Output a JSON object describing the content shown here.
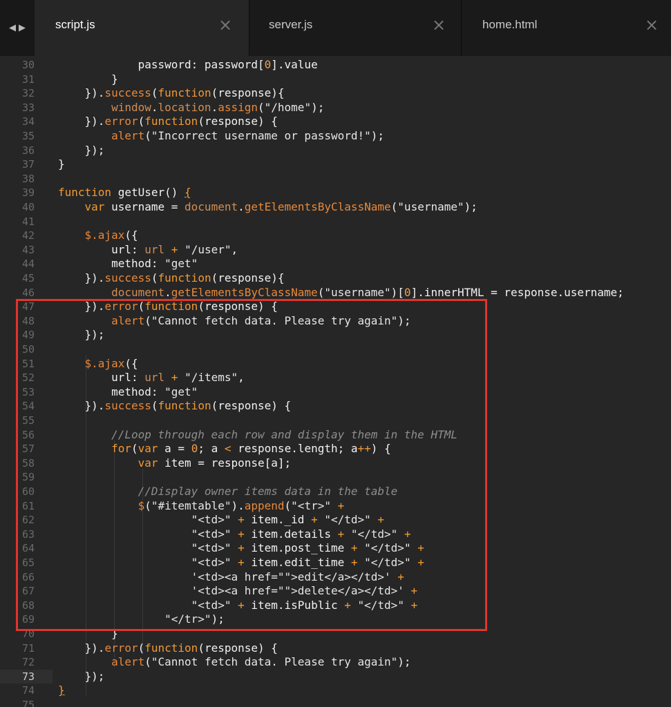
{
  "tabs": [
    {
      "label": "script.js",
      "active": true
    },
    {
      "label": "server.js",
      "active": false
    },
    {
      "label": "home.html",
      "active": false
    }
  ],
  "nav": {
    "back": "◀",
    "forward": "▶"
  },
  "icons": {
    "close": "×"
  },
  "colors": {
    "highlight_border": "#e0352e",
    "accent": "#f39a32",
    "background": "#262626"
  },
  "editor": {
    "current_line": 73,
    "lines": [
      {
        "n": "30",
        "code": [
          [
            "pl",
            "            password: password["
          ],
          [
            "num",
            "0"
          ],
          [
            "pl",
            "].value"
          ]
        ]
      },
      {
        "n": "31",
        "code": [
          [
            "pl",
            "        }"
          ]
        ]
      },
      {
        "n": "32",
        "code": [
          [
            "pl",
            "    })."
          ],
          [
            "fn",
            "success"
          ],
          [
            "pl",
            "("
          ],
          [
            "key",
            "function"
          ],
          [
            "pl",
            "(response){"
          ]
        ]
      },
      {
        "n": "33",
        "code": [
          [
            "pl",
            "        "
          ],
          [
            "glob",
            "window"
          ],
          [
            "pl",
            "."
          ],
          [
            "glob",
            "location"
          ],
          [
            "pl",
            "."
          ],
          [
            "fn",
            "assign"
          ],
          [
            "pl",
            "("
          ],
          [
            "str",
            "\"/home\""
          ],
          [
            "pl",
            ");"
          ]
        ]
      },
      {
        "n": "34",
        "code": [
          [
            "pl",
            "    })."
          ],
          [
            "fn",
            "error"
          ],
          [
            "pl",
            "("
          ],
          [
            "key",
            "function"
          ],
          [
            "pl",
            "(response) {"
          ]
        ]
      },
      {
        "n": "35",
        "code": [
          [
            "pl",
            "        "
          ],
          [
            "fn",
            "alert"
          ],
          [
            "pl",
            "("
          ],
          [
            "str",
            "\"Incorrect username or password!\""
          ],
          [
            "pl",
            ");"
          ]
        ]
      },
      {
        "n": "36",
        "code": [
          [
            "pl",
            "    });"
          ]
        ]
      },
      {
        "n": "37",
        "code": [
          [
            "pl",
            "}"
          ]
        ]
      },
      {
        "n": "38",
        "code": []
      },
      {
        "n": "39",
        "code": [
          [
            "key",
            "function"
          ],
          [
            "pl",
            " getUser() "
          ],
          [
            "u",
            "{"
          ]
        ]
      },
      {
        "n": "40",
        "code": [
          [
            "pl",
            "    "
          ],
          [
            "key",
            "var"
          ],
          [
            "pl",
            " username = "
          ],
          [
            "glob",
            "document"
          ],
          [
            "pl",
            "."
          ],
          [
            "fn",
            "getElementsByClassName"
          ],
          [
            "pl",
            "("
          ],
          [
            "str",
            "\"username\""
          ],
          [
            "pl",
            ");"
          ]
        ]
      },
      {
        "n": "41",
        "code": []
      },
      {
        "n": "42",
        "code": [
          [
            "pl",
            "    "
          ],
          [
            "fn",
            "$.ajax"
          ],
          [
            "pl",
            "({"
          ]
        ]
      },
      {
        "n": "43",
        "code": [
          [
            "pl",
            "        url: "
          ],
          [
            "glob",
            "url"
          ],
          [
            "pl",
            " "
          ],
          [
            "op",
            "+"
          ],
          [
            "pl",
            " "
          ],
          [
            "str",
            "\"/user\""
          ],
          [
            "pl",
            ","
          ]
        ]
      },
      {
        "n": "44",
        "code": [
          [
            "pl",
            "        method: "
          ],
          [
            "str",
            "\"get\""
          ]
        ]
      },
      {
        "n": "45",
        "code": [
          [
            "pl",
            "    })."
          ],
          [
            "fn",
            "success"
          ],
          [
            "pl",
            "("
          ],
          [
            "key",
            "function"
          ],
          [
            "pl",
            "(response){"
          ]
        ]
      },
      {
        "n": "46",
        "code": [
          [
            "pl",
            "        "
          ],
          [
            "glob",
            "document"
          ],
          [
            "pl",
            "."
          ],
          [
            "fn",
            "getElementsByClassName"
          ],
          [
            "pl",
            "("
          ],
          [
            "str",
            "\"username\""
          ],
          [
            "pl",
            ")["
          ],
          [
            "num",
            "0"
          ],
          [
            "pl",
            "].innerHTML = response.username;"
          ]
        ]
      },
      {
        "n": "47",
        "code": [
          [
            "pl",
            "    })."
          ],
          [
            "fn",
            "error"
          ],
          [
            "pl",
            "("
          ],
          [
            "key",
            "function"
          ],
          [
            "pl",
            "(response) {"
          ]
        ]
      },
      {
        "n": "48",
        "code": [
          [
            "pl",
            "        "
          ],
          [
            "fn",
            "alert"
          ],
          [
            "pl",
            "("
          ],
          [
            "str",
            "\"Cannot fetch data. Please try again\""
          ],
          [
            "pl",
            ");"
          ]
        ]
      },
      {
        "n": "49",
        "code": [
          [
            "pl",
            "    });"
          ]
        ]
      },
      {
        "n": "50",
        "code": []
      },
      {
        "n": "51",
        "code": [
          [
            "pl",
            "    "
          ],
          [
            "fn",
            "$.ajax"
          ],
          [
            "pl",
            "({"
          ]
        ]
      },
      {
        "n": "52",
        "code": [
          [
            "pl",
            "        url: "
          ],
          [
            "glob",
            "url"
          ],
          [
            "pl",
            " "
          ],
          [
            "op",
            "+"
          ],
          [
            "pl",
            " "
          ],
          [
            "str",
            "\"/items\""
          ],
          [
            "pl",
            ","
          ]
        ]
      },
      {
        "n": "53",
        "code": [
          [
            "pl",
            "        method: "
          ],
          [
            "str",
            "\"get\""
          ]
        ]
      },
      {
        "n": "54",
        "code": [
          [
            "pl",
            "    })."
          ],
          [
            "fn",
            "success"
          ],
          [
            "pl",
            "("
          ],
          [
            "key",
            "function"
          ],
          [
            "pl",
            "(response) {"
          ]
        ]
      },
      {
        "n": "55",
        "code": []
      },
      {
        "n": "56",
        "code": [
          [
            "pl",
            "        "
          ],
          [
            "cm",
            "//Loop through each row and display them in the HTML"
          ]
        ]
      },
      {
        "n": "57",
        "code": [
          [
            "pl",
            "        "
          ],
          [
            "key",
            "for"
          ],
          [
            "pl",
            "("
          ],
          [
            "key",
            "var"
          ],
          [
            "pl",
            " a = "
          ],
          [
            "num",
            "0"
          ],
          [
            "pl",
            "; a "
          ],
          [
            "op",
            "<"
          ],
          [
            "pl",
            " response.length; a"
          ],
          [
            "op",
            "++"
          ],
          [
            "pl",
            ") {"
          ]
        ]
      },
      {
        "n": "58",
        "code": [
          [
            "pl",
            "            "
          ],
          [
            "key",
            "var"
          ],
          [
            "pl",
            " item = response[a];"
          ]
        ]
      },
      {
        "n": "59",
        "code": []
      },
      {
        "n": "60",
        "code": [
          [
            "pl",
            "            "
          ],
          [
            "cm",
            "//Display owner items data in the table"
          ]
        ]
      },
      {
        "n": "61",
        "code": [
          [
            "pl",
            "            "
          ],
          [
            "fn",
            "$"
          ],
          [
            "pl",
            "("
          ],
          [
            "str",
            "\"#itemtable\""
          ],
          [
            "pl",
            ")."
          ],
          [
            "fn",
            "append"
          ],
          [
            "pl",
            "("
          ],
          [
            "str",
            "\"<tr>\""
          ],
          [
            "pl",
            " "
          ],
          [
            "op",
            "+"
          ]
        ]
      },
      {
        "n": "62",
        "code": [
          [
            "pl",
            "                    "
          ],
          [
            "str",
            "\"<td>\""
          ],
          [
            "pl",
            " "
          ],
          [
            "op",
            "+"
          ],
          [
            "pl",
            " item._id "
          ],
          [
            "op",
            "+"
          ],
          [
            "pl",
            " "
          ],
          [
            "str",
            "\"</td>\""
          ],
          [
            "pl",
            " "
          ],
          [
            "op",
            "+"
          ]
        ]
      },
      {
        "n": "63",
        "code": [
          [
            "pl",
            "                    "
          ],
          [
            "str",
            "\"<td>\""
          ],
          [
            "pl",
            " "
          ],
          [
            "op",
            "+"
          ],
          [
            "pl",
            " item.details "
          ],
          [
            "op",
            "+"
          ],
          [
            "pl",
            " "
          ],
          [
            "str",
            "\"</td>\""
          ],
          [
            "pl",
            " "
          ],
          [
            "op",
            "+"
          ]
        ]
      },
      {
        "n": "64",
        "code": [
          [
            "pl",
            "                    "
          ],
          [
            "str",
            "\"<td>\""
          ],
          [
            "pl",
            " "
          ],
          [
            "op",
            "+"
          ],
          [
            "pl",
            " item.post_time "
          ],
          [
            "op",
            "+"
          ],
          [
            "pl",
            " "
          ],
          [
            "str",
            "\"</td>\""
          ],
          [
            "pl",
            " "
          ],
          [
            "op",
            "+"
          ]
        ]
      },
      {
        "n": "65",
        "code": [
          [
            "pl",
            "                    "
          ],
          [
            "str",
            "\"<td>\""
          ],
          [
            "pl",
            " "
          ],
          [
            "op",
            "+"
          ],
          [
            "pl",
            " item.edit_time "
          ],
          [
            "op",
            "+"
          ],
          [
            "pl",
            " "
          ],
          [
            "str",
            "\"</td>\""
          ],
          [
            "pl",
            " "
          ],
          [
            "op",
            "+"
          ]
        ]
      },
      {
        "n": "66",
        "code": [
          [
            "pl",
            "                    "
          ],
          [
            "str",
            "'<td><a href=\"\">edit</a></td>'"
          ],
          [
            "pl",
            " "
          ],
          [
            "op",
            "+"
          ]
        ]
      },
      {
        "n": "67",
        "code": [
          [
            "pl",
            "                    "
          ],
          [
            "str",
            "'<td><a href=\"\">delete</a></td>'"
          ],
          [
            "pl",
            " "
          ],
          [
            "op",
            "+"
          ]
        ]
      },
      {
        "n": "68",
        "code": [
          [
            "pl",
            "                    "
          ],
          [
            "str",
            "\"<td>\""
          ],
          [
            "pl",
            " "
          ],
          [
            "op",
            "+"
          ],
          [
            "pl",
            " item.isPublic "
          ],
          [
            "op",
            "+"
          ],
          [
            "pl",
            " "
          ],
          [
            "str",
            "\"</td>\""
          ],
          [
            "pl",
            " "
          ],
          [
            "op",
            "+"
          ]
        ]
      },
      {
        "n": "69",
        "code": [
          [
            "pl",
            "                "
          ],
          [
            "str",
            "\"</tr>\""
          ],
          [
            "pl",
            ");"
          ]
        ]
      },
      {
        "n": "70",
        "code": [
          [
            "pl",
            "        }"
          ]
        ]
      },
      {
        "n": "71",
        "code": [
          [
            "pl",
            "    })."
          ],
          [
            "fn",
            "error"
          ],
          [
            "pl",
            "("
          ],
          [
            "key",
            "function"
          ],
          [
            "pl",
            "(response) {"
          ]
        ]
      },
      {
        "n": "72",
        "code": [
          [
            "pl",
            "        "
          ],
          [
            "fn",
            "alert"
          ],
          [
            "pl",
            "("
          ],
          [
            "str",
            "\"Cannot fetch data. Please try again\""
          ],
          [
            "pl",
            ");"
          ]
        ]
      },
      {
        "n": "73",
        "code": [
          [
            "pl",
            "    });"
          ]
        ]
      },
      {
        "n": "74",
        "code": [
          [
            "u",
            "}"
          ]
        ]
      },
      {
        "n": "75",
        "code": []
      }
    ]
  }
}
